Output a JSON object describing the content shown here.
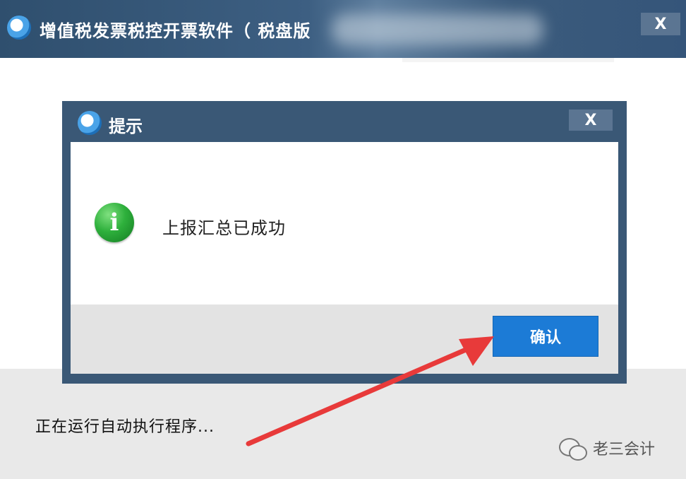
{
  "main_window": {
    "title": "增值税发票税控开票软件（  税盘版",
    "close_label": "X"
  },
  "dialog": {
    "title": "提示",
    "close_label": "X",
    "message": "上报汇总已成功",
    "confirm_label": "确认"
  },
  "status": {
    "text": "正在运行自动执行程序..."
  },
  "watermark": {
    "text": "老三会计"
  },
  "colors": {
    "titlebar": "#3a5876",
    "confirm_button": "#1c7bd6",
    "annotation_arrow": "#e83a3a",
    "info_icon": "#2eb03c"
  }
}
